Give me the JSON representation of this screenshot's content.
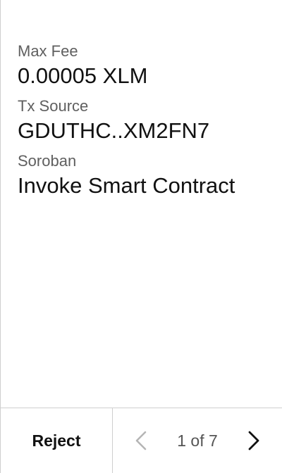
{
  "fields": [
    {
      "label": "Max Fee",
      "value": "0.00005 XLM"
    },
    {
      "label": "Tx Source",
      "value": "GDUTHC..XM2FN7"
    },
    {
      "label": "Soroban",
      "value": "Invoke Smart Contract"
    }
  ],
  "footer": {
    "reject_label": "Reject",
    "page_indicator": "1 of 7",
    "prev_icon": "chevron-left-icon",
    "next_icon": "chevron-right-icon"
  },
  "colors": {
    "text": "#111111",
    "label": "#5f5f5f",
    "divider": "#cfcfcf",
    "disabled_icon": "#b5b5b5"
  }
}
